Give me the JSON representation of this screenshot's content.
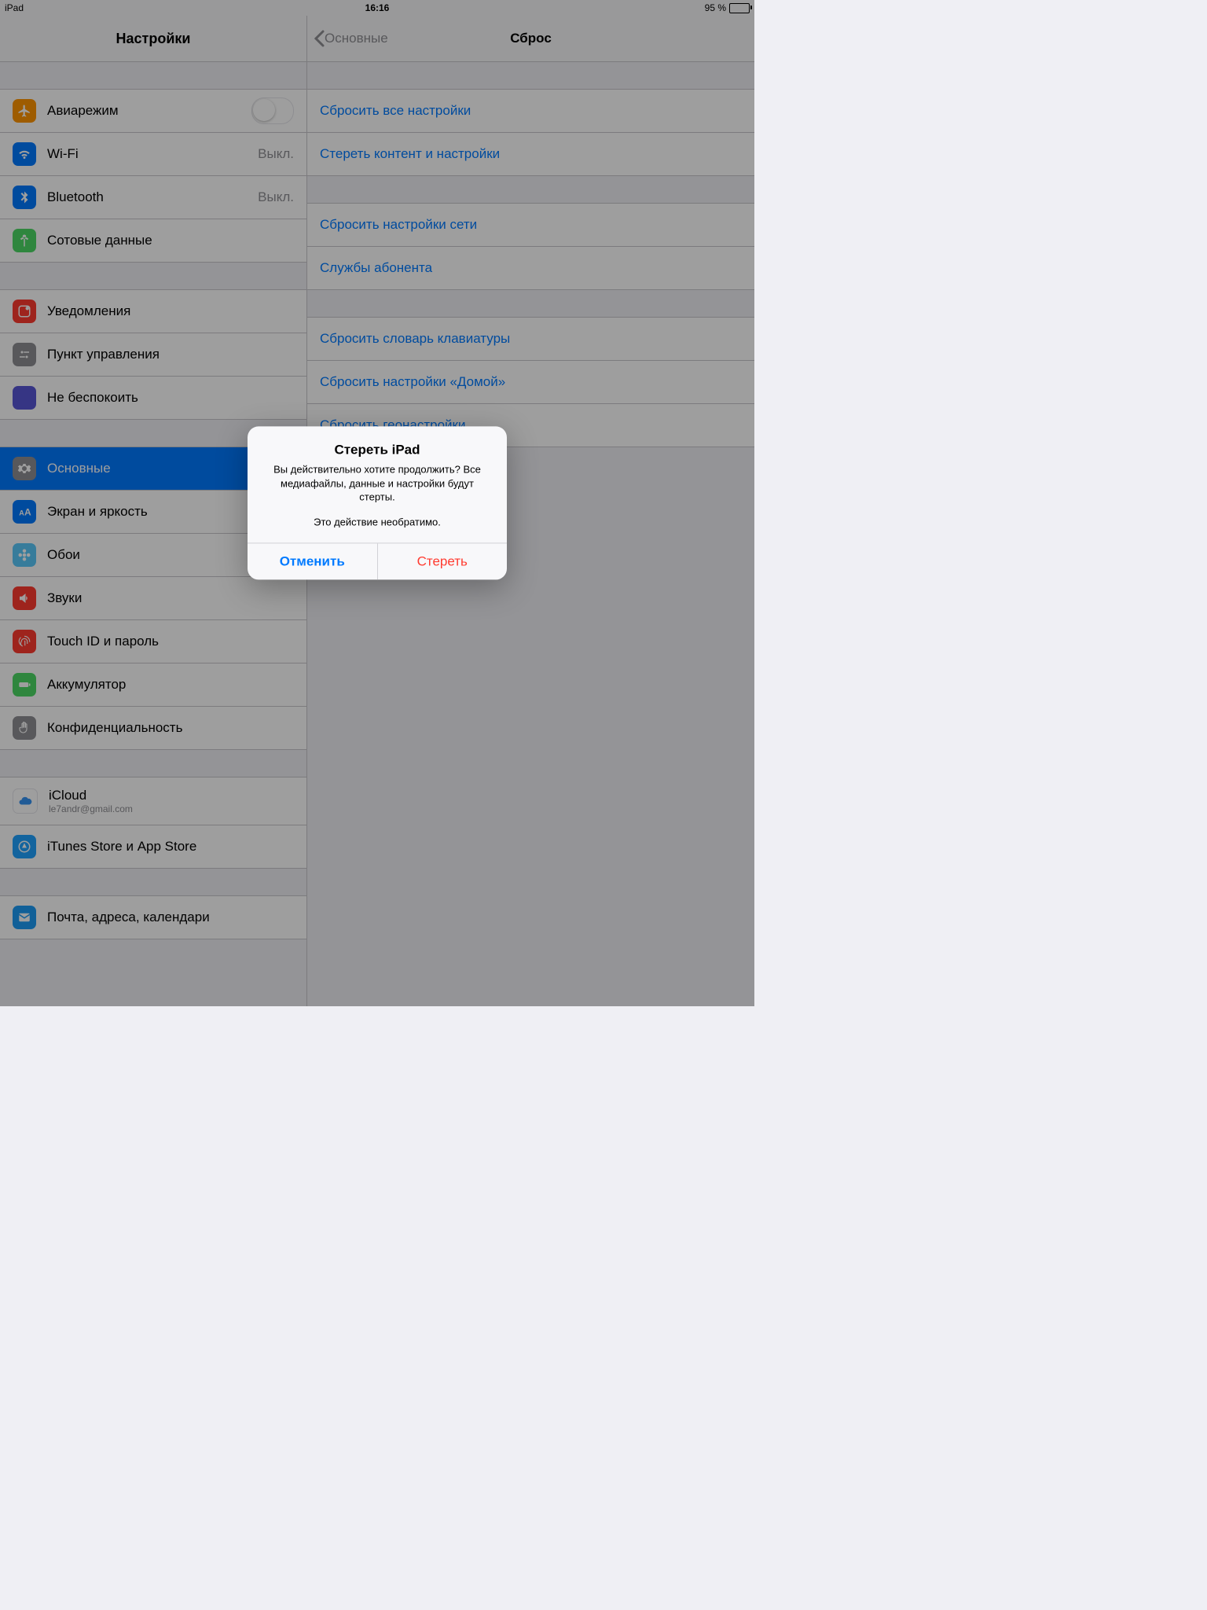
{
  "statusbar": {
    "device": "iPad",
    "time": "16:16",
    "battery": "95 %"
  },
  "sidebar": {
    "title": "Настройки",
    "g1": [
      {
        "label": "Авиарежим"
      },
      {
        "label": "Wi-Fi",
        "value": "Выкл."
      },
      {
        "label": "Bluetooth",
        "value": "Выкл."
      },
      {
        "label": "Сотовые данные"
      }
    ],
    "g2": [
      {
        "label": "Уведомления"
      },
      {
        "label": "Пункт управления"
      },
      {
        "label": "Не беспокоить"
      }
    ],
    "g3": [
      {
        "label": "Основные"
      },
      {
        "label": "Экран и яркость"
      },
      {
        "label": "Обои"
      },
      {
        "label": "Звуки"
      },
      {
        "label": "Touch ID и пароль"
      },
      {
        "label": "Аккумулятор"
      },
      {
        "label": "Конфиденциальность"
      }
    ],
    "g4": [
      {
        "label": "iCloud",
        "sub": "le7andr@gmail.com"
      },
      {
        "label": "iTunes Store и App Store"
      }
    ],
    "g5": [
      {
        "label": "Почта, адреса, календари"
      }
    ]
  },
  "detail": {
    "back": "Основные",
    "title": "Сброс",
    "g1": [
      "Сбросить все настройки",
      "Стереть контент и настройки"
    ],
    "g2": [
      "Сбросить настройки сети",
      "Службы абонента"
    ],
    "g3": [
      "Сбросить словарь клавиатуры",
      "Сбросить настройки «Домой»",
      "Сбросить геонастройки"
    ]
  },
  "alert": {
    "title": "Стереть iPad",
    "message1": "Вы действительно хотите продолжить? Все медиафайлы, данные и настройки будут стерты.",
    "message2": "Это действие необратимо.",
    "cancel": "Отменить",
    "confirm": "Стереть"
  }
}
